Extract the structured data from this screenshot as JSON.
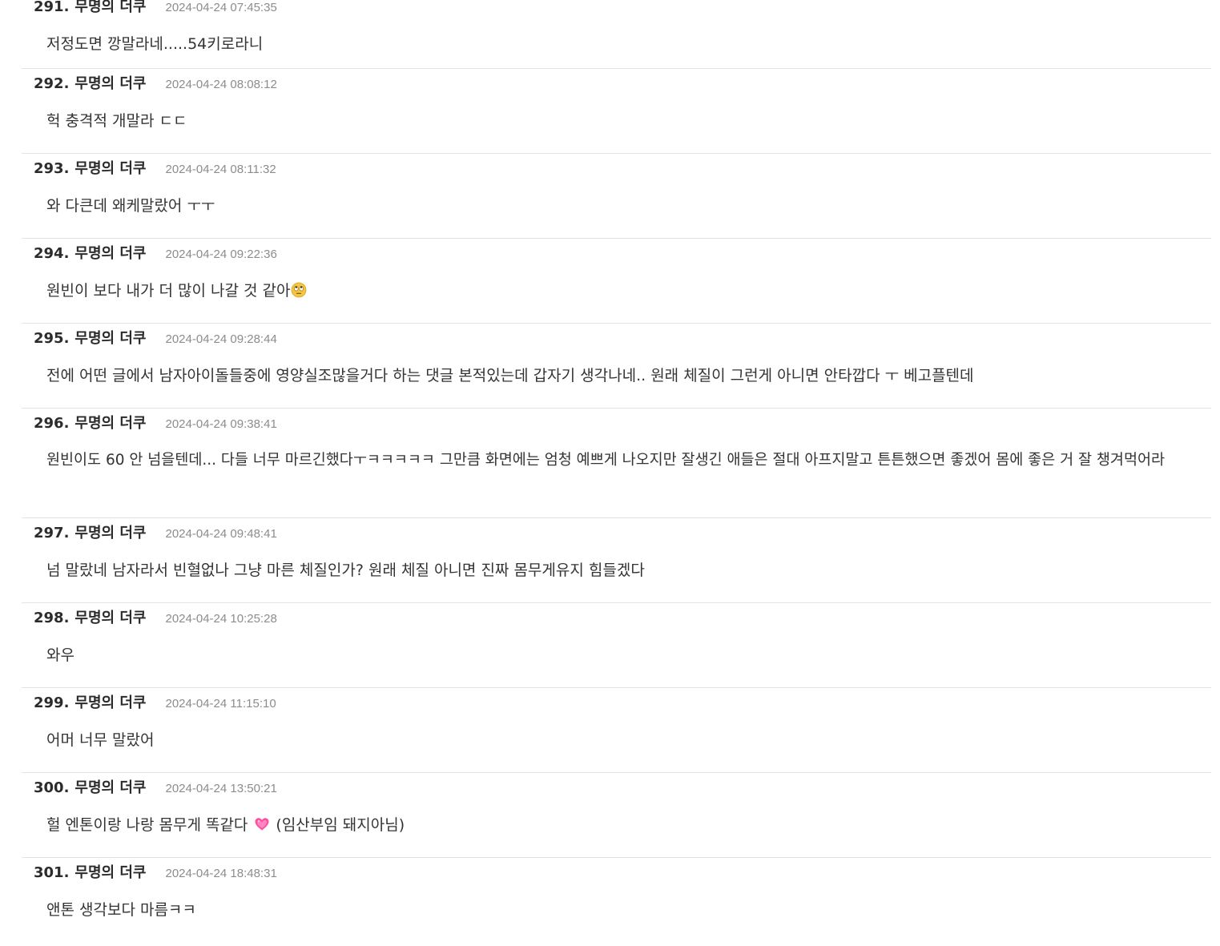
{
  "comments": [
    {
      "num": "291.",
      "author": "무명의 더쿠",
      "date": "2024-04-24 07:45:35",
      "text": "저정도면 깡말라네.....54키로라니"
    },
    {
      "num": "292.",
      "author": "무명의 더쿠",
      "date": "2024-04-24 08:08:12",
      "text": "헉 충격적 개말라 ㄷㄷ"
    },
    {
      "num": "293.",
      "author": "무명의 더쿠",
      "date": "2024-04-24 08:11:32",
      "text": "와 다큰데 왜케말랐어 ㅜㅜ"
    },
    {
      "num": "294.",
      "author": "무명의 더쿠",
      "date": "2024-04-24 09:22:36",
      "text": "원빈이 보다 내가 더 많이 나갈 것 같아",
      "emoji": "rolling-eyes-emoji"
    },
    {
      "num": "295.",
      "author": "무명의 더쿠",
      "date": "2024-04-24 09:28:44",
      "text": "전에 어떤 글에서 남자아이돌들중에 영양실조많을거다 하는 댓글 본적있는데 갑자기 생각나네.. 원래 체질이 그런게 아니면 안타깝다 ㅜ 베고플텐데"
    },
    {
      "num": "296.",
      "author": "무명의 더쿠",
      "date": "2024-04-24 09:38:41",
      "text": "원빈이도 60 안 넘을텐데... 다들 너무 마르긴했다ㅜㅋㅋㅋㅋㅋ 그만큼 화면에는 엄청 예쁘게 나오지만 잘생긴 애들은 절대 아프지말고 튼튼했으면 좋겠어 몸에 좋은 거 잘 챙겨먹어라"
    },
    {
      "num": "297.",
      "author": "무명의 더쿠",
      "date": "2024-04-24 09:48:41",
      "text": "넘 말랐네 남자라서 빈혈없나 그냥 마른 체질인가? 원래 체질 아니면 진짜 몸무게유지 힘들겠다"
    },
    {
      "num": "298.",
      "author": "무명의 더쿠",
      "date": "2024-04-24 10:25:28",
      "text": "와우"
    },
    {
      "num": "299.",
      "author": "무명의 더쿠",
      "date": "2024-04-24 11:15:10",
      "text": "어머 너무 말랐어"
    },
    {
      "num": "300.",
      "author": "무명의 더쿠",
      "date": "2024-04-24 13:50:21",
      "text": "헐 엔톤이랑 나랑 몸무게 똑같다",
      "emoji": "heart-icon",
      "text_after": "(임산부임 돼지아님)"
    },
    {
      "num": "301.",
      "author": "무명의 더쿠",
      "date": "2024-04-24 18:48:31",
      "text": "앤톤 생각보다 마름ㅋㅋ"
    }
  ],
  "colors": {
    "divider": "#e3e3e3",
    "date": "#8c8c8c",
    "text": "#333333",
    "heart": "#ff4fa0"
  }
}
